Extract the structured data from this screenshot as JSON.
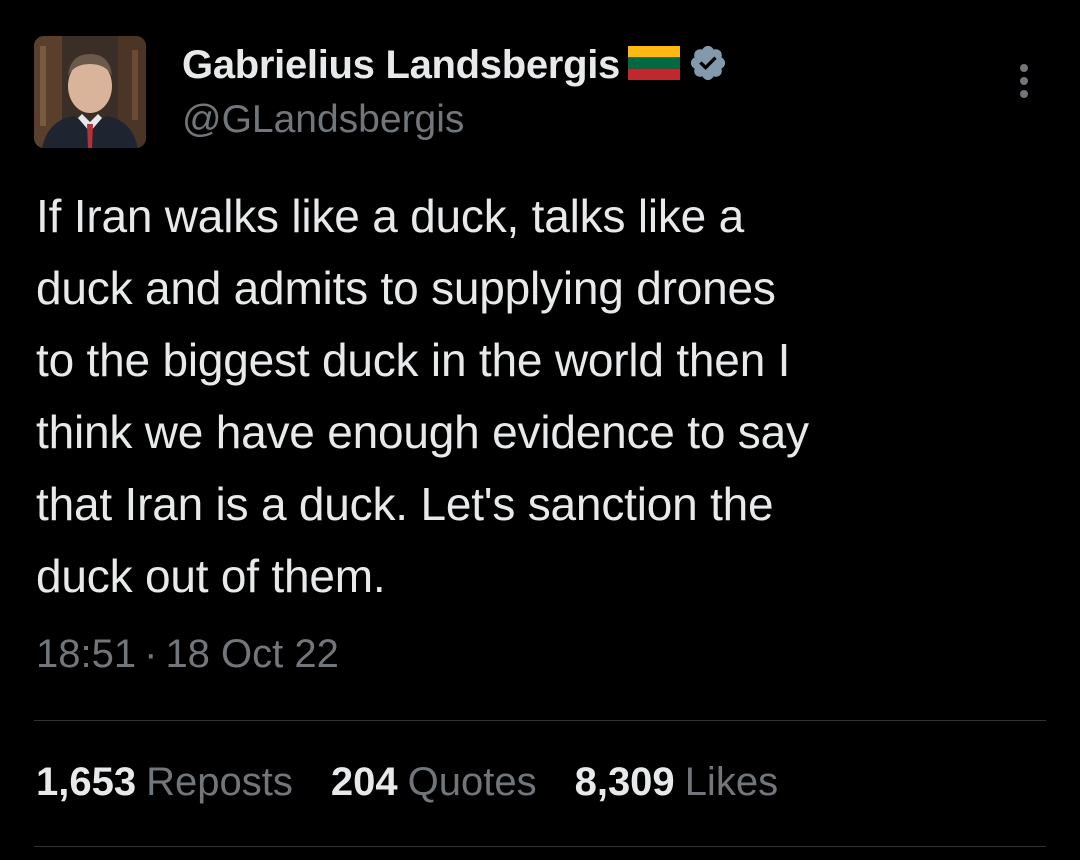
{
  "author": {
    "name": "Gabrielius Landsbergis",
    "handle": "@GLandsbergis",
    "flag_icon": "lithuania-flag-icon",
    "verified_icon": "verified-badge-icon",
    "verified_color": "#829aab"
  },
  "tweet": {
    "text": "If Iran walks like a duck, talks like a\nduck and admits to supplying drones\nto the biggest duck in the world then I\nthink we have enough evidence to say\nthat Iran is a duck. Let's sanction the\nduck out of them.",
    "time": "18:51",
    "separator": "·",
    "date": "18 Oct 22"
  },
  "stats": {
    "reposts_count": "1,653",
    "reposts_label": "Reposts",
    "quotes_count": "204",
    "quotes_label": "Quotes",
    "likes_count": "8,309",
    "likes_label": "Likes"
  },
  "colors": {
    "background": "#000000",
    "primary_text": "#e7e9ea",
    "secondary_text": "#71767b",
    "divider": "#2f3336"
  }
}
